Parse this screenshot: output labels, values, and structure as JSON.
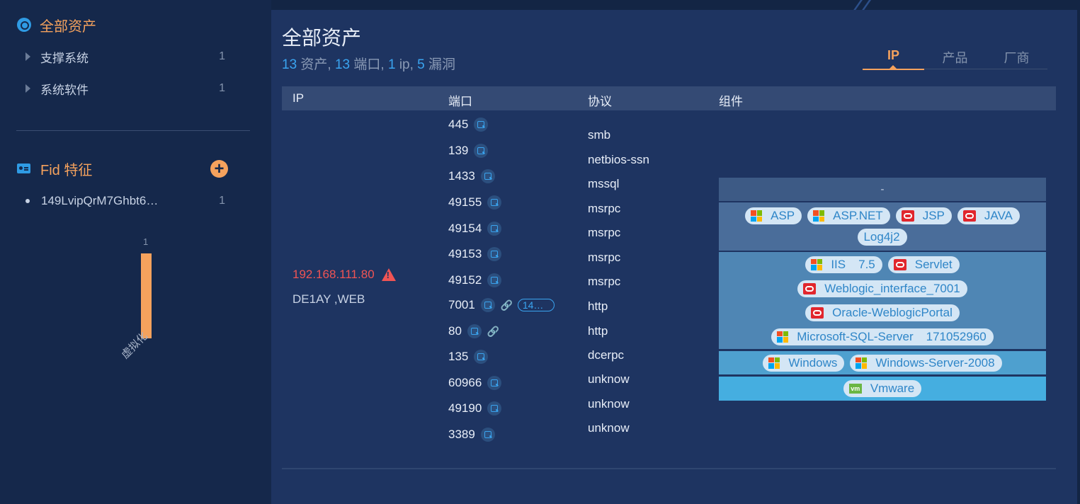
{
  "sidebar": {
    "title": "全部资产",
    "categories": [
      {
        "label": "支撑系统",
        "count": "1"
      },
      {
        "label": "系统软件",
        "count": "1"
      }
    ],
    "fid": {
      "title": "Fid 特征",
      "items": [
        {
          "label": "149LvipQrM7Ghbt6…",
          "count": "1"
        }
      ]
    },
    "chart_data": {
      "type": "bar",
      "categories": [
        "虚拟化"
      ],
      "values": [
        1
      ],
      "data_labels": [
        "1"
      ]
    }
  },
  "main": {
    "title": "全部资产",
    "summary": {
      "assets_num": "13",
      "assets_label": " 资产, ",
      "ports_num": "13",
      "ports_label": " 端口, ",
      "ip_num": "1",
      "ip_label": " ip, ",
      "vuln_num": "5",
      "vuln_label": " 漏洞"
    },
    "tabs": [
      "IP",
      "产品",
      "厂商"
    ],
    "active_tab": "IP",
    "columns": [
      "IP",
      "端口",
      "协议",
      "组件"
    ],
    "row": {
      "ip": "192.168.111.80",
      "host": "DE1AY ,WEB",
      "ports": [
        {
          "port": "445"
        },
        {
          "port": "139"
        },
        {
          "port": "1433"
        },
        {
          "port": "49155"
        },
        {
          "port": "49154"
        },
        {
          "port": "49153"
        },
        {
          "port": "49152"
        },
        {
          "port": "7001",
          "link": true,
          "tag": "14…"
        },
        {
          "port": "80",
          "link": true
        },
        {
          "port": "135"
        },
        {
          "port": "60966"
        },
        {
          "port": "49190"
        },
        {
          "port": "3389"
        }
      ],
      "protocols": [
        "smb",
        "netbios-ssn",
        "mssql",
        "msrpc",
        "msrpc",
        "msrpc",
        "msrpc",
        "http",
        "http",
        "dcerpc",
        "unknow",
        "unknow",
        "unknow"
      ],
      "components": {
        "dash": "-",
        "layer2": [
          {
            "name": "ASP",
            "logo": "microsoft-icon"
          },
          {
            "name": "ASP.NET",
            "logo": "microsoft-icon"
          },
          {
            "name": "JSP",
            "logo": "oracle-icon"
          },
          {
            "name": "JAVA",
            "logo": "oracle-icon"
          },
          {
            "name": "Log4j2",
            "logo": ""
          }
        ],
        "layer3": [
          {
            "name": "IIS",
            "version": "7.5",
            "logo": "microsoft-icon"
          },
          {
            "name": "Servlet",
            "logo": "oracle-icon"
          },
          {
            "name": "Weblogic_interface_7001",
            "logo": "oracle-icon"
          },
          {
            "name": "Oracle-WeblogicPortal",
            "logo": "oracle-icon"
          },
          {
            "name": "Microsoft-SQL-Server",
            "version": "171052960",
            "logo": "microsoft-icon"
          }
        ],
        "layer4": [
          {
            "name": "Windows",
            "logo": "microsoft-icon"
          },
          {
            "name": "Windows-Server-2008",
            "logo": "microsoft-icon"
          }
        ],
        "layer5": [
          {
            "name": "Vmware",
            "logo": "vmware-icon"
          }
        ]
      }
    }
  },
  "colors": {
    "accent": "#f5a25d",
    "link": "#3aa4f0",
    "danger": "#f05454",
    "layer1": "#3d5a85",
    "layer2": "#4a6d9a",
    "layer3": "#4f86b4",
    "layer4": "#4ea0cf",
    "layer5": "#45aee0"
  }
}
